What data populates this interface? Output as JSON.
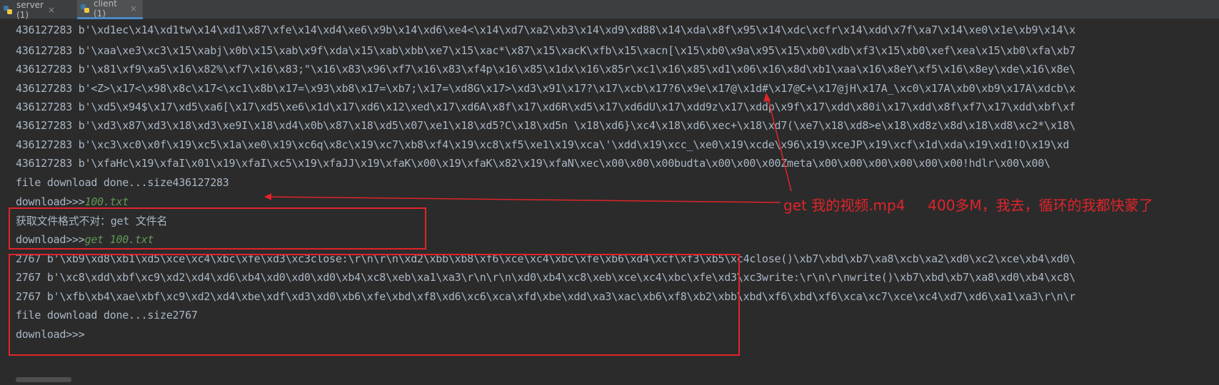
{
  "tabs": [
    {
      "label": "server (1)",
      "close": "×"
    },
    {
      "label": "client (1)",
      "close": "×"
    }
  ],
  "console": {
    "lines1": [
      "436127283 b'\\xd1ec\\x14\\xd1tw\\x14\\xd1\\x87\\xfe\\x14\\xd4\\xe6\\x9b\\x14\\xd6\\xe4<\\x14\\xd7\\xa2\\xb3\\x14\\xd9\\xd88\\x14\\xda\\x8f\\x95\\x14\\xdc\\xcfr\\x14\\xdd\\x7f\\xa7\\x14\\xe0\\x1e\\xb9\\x14\\x",
      "436127283 b'\\xaa\\xe3\\xc3\\x15\\xabj\\x0b\\x15\\xab\\x9f\\xda\\x15\\xab\\xbb\\xe7\\x15\\xac*\\x87\\x15\\xacK\\xfb\\x15\\xacn[\\x15\\xb0\\x9a\\x95\\x15\\xb0\\xdb\\xf3\\x15\\xb0\\xef\\xea\\x15\\xb0\\xfa\\xb7",
      "436127283 b'\\x81\\xf9\\xa5\\x16\\x82%\\xf7\\x16\\x83;\"\\x16\\x83\\x96\\xf7\\x16\\x83\\xf4p\\x16\\x85\\x1dx\\x16\\x85r\\xc1\\x16\\x85\\xd1\\x06\\x16\\x8d\\xb1\\xaa\\x16\\x8eY\\xf5\\x16\\x8ey\\xde\\x16\\x8e\\",
      "436127283 b'<Z>\\x17<\\x98\\x8c\\x17<\\xc1\\x8b\\x17=\\x93\\xb8\\x17=\\xb7;\\x17=\\xd8G\\x17>\\xd3\\x91\\x17?\\x17\\xcb\\x17?6\\x9e\\x17@\\x1d#\\x17@C+\\x17@jH\\x17A_\\xc0\\x17A\\xb0\\xb9\\x17A\\xdcb\\x",
      "436127283 b'\\xd5\\x94$\\x17\\xd5\\xa6[\\x17\\xd5\\xe6\\x1d\\x17\\xd6\\x12\\xed\\x17\\xd6A\\x8f\\x17\\xd6R\\xd5\\x17\\xd6dU\\x17\\xdd9z\\x17\\xddp\\x9f\\x17\\xdd\\x80i\\x17\\xdd\\x8f\\xf7\\x17\\xdd\\xbf\\xf",
      "436127283 b'\\xd3\\x87\\xd3\\x18\\xd3\\xe9I\\x18\\xd4\\x0b\\x87\\x18\\xd5\\x07\\xe1\\x18\\xd5?C\\x18\\xd5n \\x18\\xd6}\\xc4\\x18\\xd6\\xec+\\x18\\xd7(\\xe7\\x18\\xd8>e\\x18\\xd8z\\x8d\\x18\\xd8\\xc2*\\x18\\",
      "436127283 b'\\xc3\\xc0\\x0f\\x19\\xc5\\x1a\\xe0\\x19\\xc6q\\x8c\\x19\\xc7\\xb8\\xf4\\x19\\xc8\\xf5\\xe1\\x19\\xca\\'\\xdd\\x19\\xcc_\\xe0\\x19\\xcde\\x96\\x19\\xceJP\\x19\\xcf\\x1d\\xda\\x19\\xd1!O\\x19\\xd",
      "436127283 b'\\xfaHc\\x19\\xfaI\\x01\\x19\\xfaI\\xc5\\x19\\xfaJJ\\x19\\xfaK\\x00\\x19\\xfaK\\x82\\x19\\xfaN\\xec\\x00\\x00\\x00budta\\x00\\x00\\x00Zmeta\\x00\\x00\\x00\\x00\\x00\\x00!hdlr\\x00\\x00\\",
      "file download done...size436127283"
    ],
    "prompt1": "download>>>",
    "input1": "100.txt",
    "error1": "获取文件格式不对：get 文件名",
    "prompt2": "download>>>",
    "input2": "get 100.txt",
    "lines2": [
      "2767 b'\\xb9\\xd8\\xb1\\xd5\\xce\\xc4\\xbc\\xfe\\xd3\\xc3close:\\r\\n\\r\\n\\xd2\\xbb\\xb8\\xf6\\xce\\xc4\\xbc\\xfe\\xb6\\xd4\\xcf\\xf3\\xb5\\xc4close()\\xb7\\xbd\\xb7\\xa8\\xcb\\xa2\\xd0\\xc2\\xce\\xb4\\xd0\\",
      "2767 b'\\xc8\\xdd\\xbf\\xc9\\xd2\\xd4\\xd6\\xb4\\xd0\\xd0\\xd0\\xb4\\xc8\\xeb\\xa1\\xa3\\r\\n\\r\\n\\xd0\\xb4\\xc8\\xeb\\xce\\xc4\\xbc\\xfe\\xd3\\xc3write:\\r\\n\\r\\nwrite()\\xb7\\xbd\\xb7\\xa8\\xd0\\xb4\\xc8\\",
      "2767 b'\\xfb\\xb4\\xae\\xbf\\xc9\\xd2\\xd4\\xbe\\xdf\\xd3\\xd0\\xb6\\xfe\\xbd\\xf8\\xd6\\xc6\\xca\\xfd\\xbe\\xdd\\xa3\\xac\\xb6\\xf8\\xb2\\xbb\\xbd\\xf6\\xbd\\xf6\\xca\\xc7\\xce\\xc4\\xd7\\xd6\\xa1\\xa3\\r\\n\\r",
      "file download done...size2767"
    ],
    "prompt3": "download>>>"
  },
  "annotation": "get 我的视频.mp4     400多M，我去，循环的我都快蒙了",
  "colors": {
    "background": "#2b2b2b",
    "text": "#a9b7c6",
    "user_input": "#629755",
    "annotation": "#e0242a"
  },
  "icons": [
    "python-file-icon",
    "close-icon"
  ]
}
